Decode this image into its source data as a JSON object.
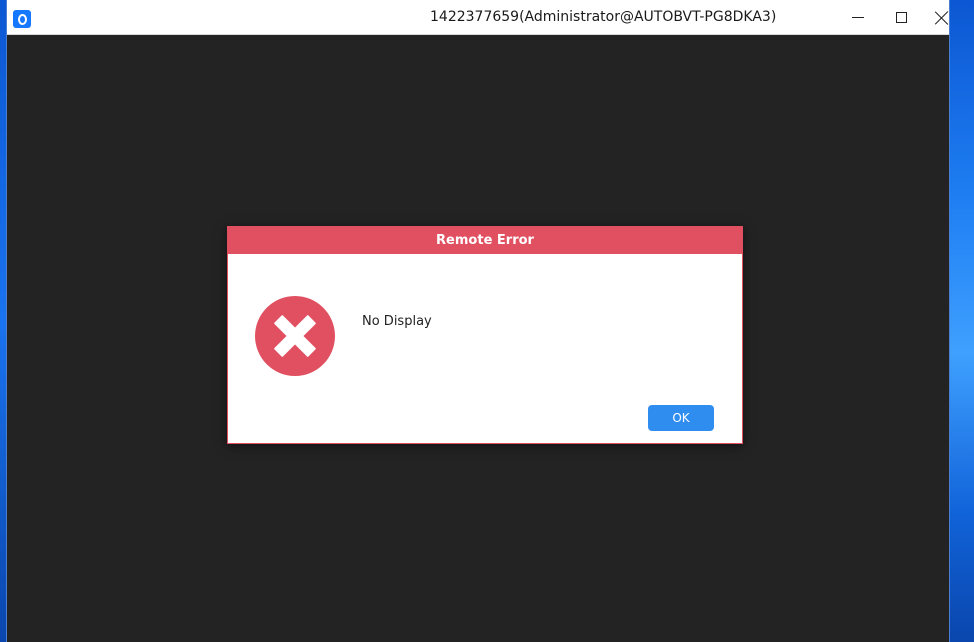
{
  "window": {
    "title": "1422377659(Administrator@AUTOBVT-PG8DKA3)",
    "app_icon": "remote-desktop-app-icon",
    "controls": {
      "minimize": "minimize-icon",
      "maximize": "maximize-icon",
      "close": "close-icon"
    },
    "background_color": "#232323"
  },
  "dialog": {
    "title": "Remote Error",
    "message": "No Display",
    "icon": "error-x-icon",
    "ok_label": "OK",
    "accent_color": "#e05061",
    "button_color": "#2f8df0"
  }
}
